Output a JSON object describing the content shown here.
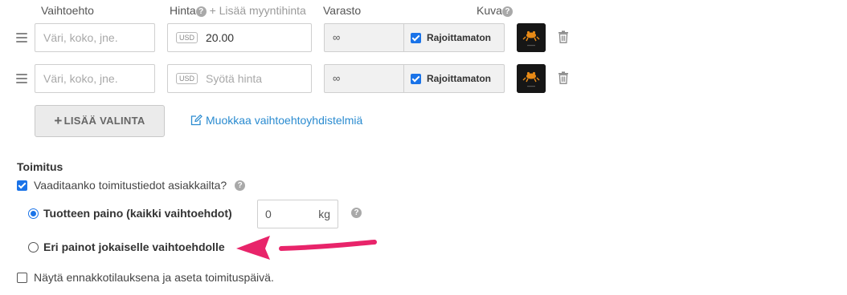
{
  "headers": {
    "option": "Vaihtoehto",
    "price": "Hinta",
    "price_hint": "+ Lisää myyntihinta",
    "stock": "Varasto",
    "image": "Kuva"
  },
  "variants": [
    {
      "option_placeholder": "Väri, koko, jne.",
      "currency": "USD",
      "price_value": "20.00",
      "price_placeholder": "",
      "stock_value": "∞",
      "unlimited_label": "Rajoittamaton",
      "unlimited_checked": true,
      "image_icon": "product-thumbnail"
    },
    {
      "option_placeholder": "Väri, koko, jne.",
      "currency": "USD",
      "price_value": "",
      "price_placeholder": "Syötä hinta",
      "stock_value": "∞",
      "unlimited_label": "Rajoittamaton",
      "unlimited_checked": true,
      "image_icon": "product-thumbnail"
    }
  ],
  "actions": {
    "add_choice_label": "LISÄÄ VALINTA",
    "edit_combinations_label": "Muokkaa vaihtoehtoyhdistelmiä"
  },
  "shipping": {
    "title": "Toimitus",
    "require_shipping_label": "Vaaditaanko toimitustiedot asiakkailta?",
    "require_shipping_checked": true,
    "product_weight_label": "Tuotteen paino (kaikki vaihtoehdot)",
    "product_weight_selected": true,
    "weight_value": "0",
    "weight_unit": "kg",
    "separate_weights_label": "Eri painot jokaiselle vaihtoehdolle",
    "separate_weights_selected": false,
    "preorder_label": "Näytä ennakkotilauksena ja aseta toimituspäivä.",
    "preorder_checked": false
  },
  "colors": {
    "accent": "#1a73e8",
    "link": "#2a8bd0",
    "arrow": "#e8246a"
  }
}
